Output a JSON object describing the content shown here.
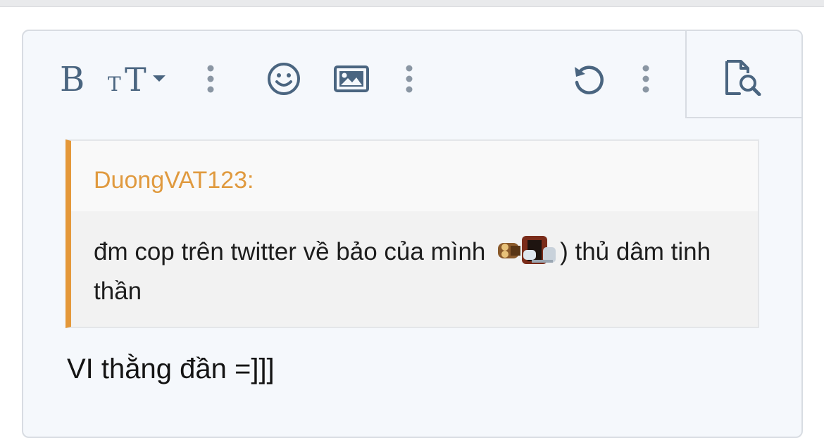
{
  "toolbar": {
    "bold_icon": "bold-icon",
    "text_size_icon": "text-size-icon",
    "more_icon": "vertical-ellipsis-icon",
    "smilies_icon": "smiley-icon",
    "image_icon": "image-icon",
    "undo_icon": "undo-icon",
    "preview_icon": "preview-icon"
  },
  "quote": {
    "author": "DuongVAT123:",
    "text_before": "đm cop trên twitter về bảo của mình ",
    "smiley": "emoticon-image",
    "text_after": ") thủ dâm tinh thần"
  },
  "reply": {
    "text": "VI thằng đần =]]]"
  },
  "colors": {
    "accent": "#e4983a",
    "icon": "#4a6580",
    "editor_bg": "#f5f8fc",
    "border": "#d8dce2"
  }
}
